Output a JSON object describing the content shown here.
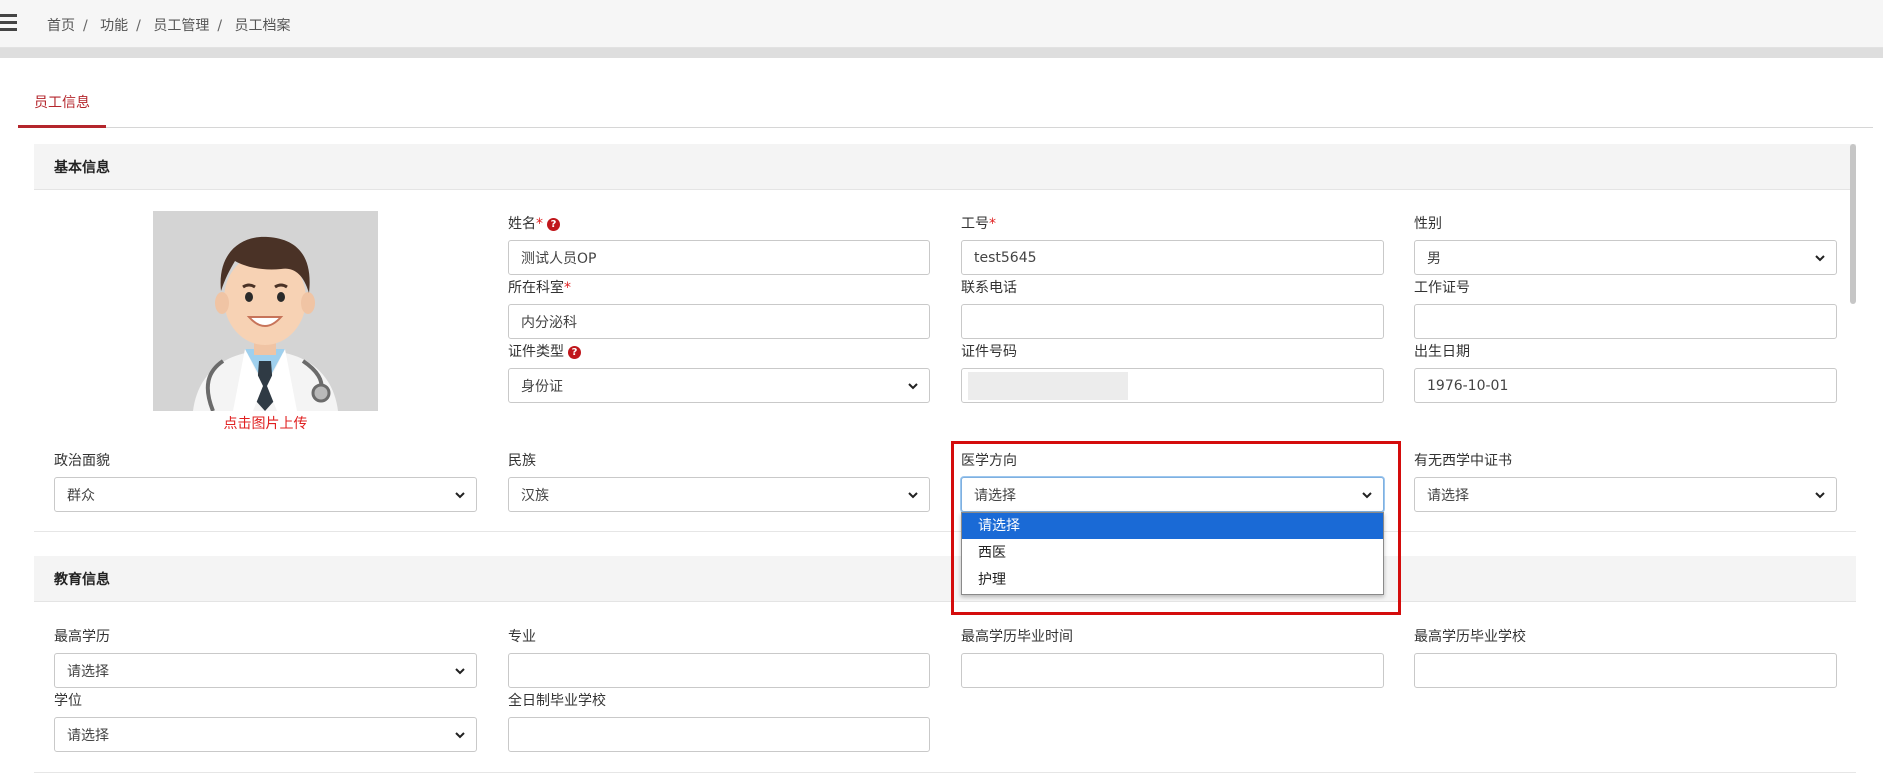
{
  "breadcrumb": [
    "首页",
    "功能",
    "员工管理",
    "员工档案"
  ],
  "tabs": {
    "staff_info": "员工信息"
  },
  "sections": {
    "basic": "基本信息",
    "education": "教育信息"
  },
  "photo": {
    "upload_text": "点击图片上传"
  },
  "fields": {
    "name": {
      "label": "姓名",
      "required": "*",
      "value": "测试人员OP"
    },
    "employee_no": {
      "label": "工号",
      "required": "*",
      "value": "test5645"
    },
    "gender": {
      "label": "性别",
      "value": "男"
    },
    "department": {
      "label": "所在科室",
      "required": "*",
      "value": "内分泌科"
    },
    "phone": {
      "label": "联系电话",
      "value": ""
    },
    "work_cert_no": {
      "label": "工作证号",
      "value": ""
    },
    "id_type": {
      "label": "证件类型",
      "value": "身份证"
    },
    "id_number": {
      "label": "证件号码",
      "value": ""
    },
    "birth_date": {
      "label": "出生日期",
      "value": "1976-10-01"
    },
    "political_status": {
      "label": "政治面貌",
      "value": "群众"
    },
    "ethnicity": {
      "label": "民族",
      "value": "汉族"
    },
    "medical_direction": {
      "label": "医学方向",
      "value": "请选择",
      "options": [
        "请选择",
        "西医",
        "护理"
      ]
    },
    "western_cert": {
      "label": "有无西学中证书",
      "value": "请选择"
    },
    "highest_degree": {
      "label": "最高学历",
      "value": "请选择"
    },
    "major": {
      "label": "专业",
      "value": ""
    },
    "grad_time": {
      "label": "最高学历毕业时间",
      "value": ""
    },
    "grad_school": {
      "label": "最高学历毕业学校",
      "value": ""
    },
    "degree": {
      "label": "学位",
      "value": "请选择"
    },
    "fulltime_school": {
      "label": "全日制毕业学校",
      "value": ""
    }
  },
  "colors": {
    "accent": "#b4262c",
    "required": "#e02020",
    "option_highlight": "#1a6ad6",
    "callout": "#d40c0c"
  }
}
